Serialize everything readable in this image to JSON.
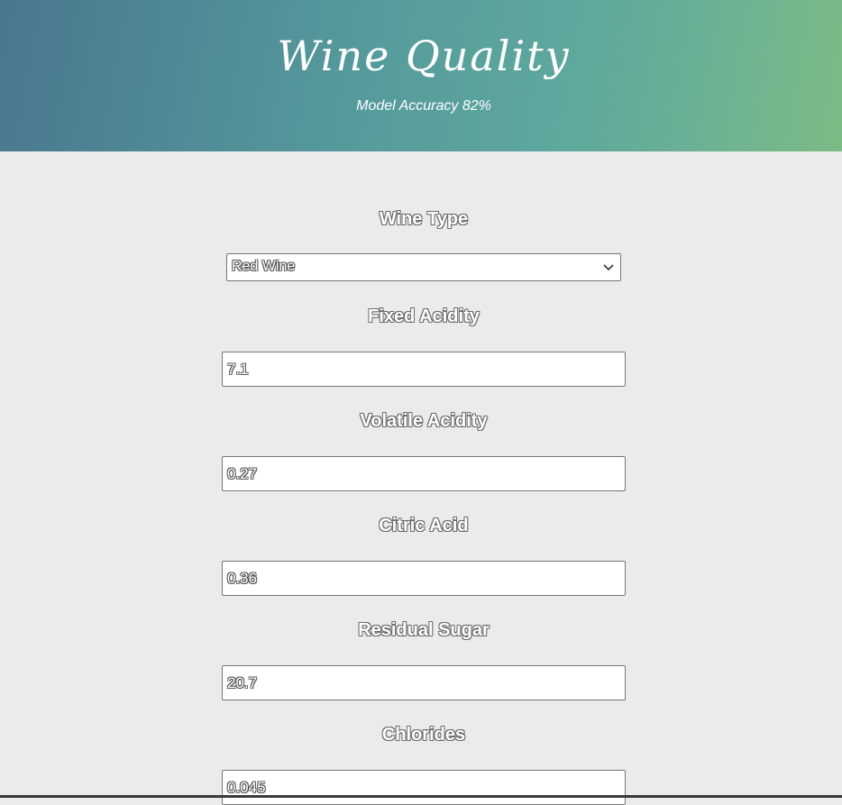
{
  "header": {
    "title": "Wine Quality",
    "subtitle": "Model Accuracy 82%"
  },
  "form": {
    "wine_type": {
      "label": "Wine Type",
      "selected": "Red Wine"
    },
    "fields": [
      {
        "label": "Fixed Acidity",
        "value": "7.1"
      },
      {
        "label": "Volatile Acidity",
        "value": "0.27"
      },
      {
        "label": "Citric Acid",
        "value": "0.36"
      },
      {
        "label": "Residual Sugar",
        "value": "20.7"
      },
      {
        "label": "Chlorides",
        "value": "0.045"
      }
    ]
  },
  "colors": {
    "header_gradient_start": "#4a7790",
    "header_gradient_end": "#7cbb86",
    "page_background": "#ebebeb"
  }
}
